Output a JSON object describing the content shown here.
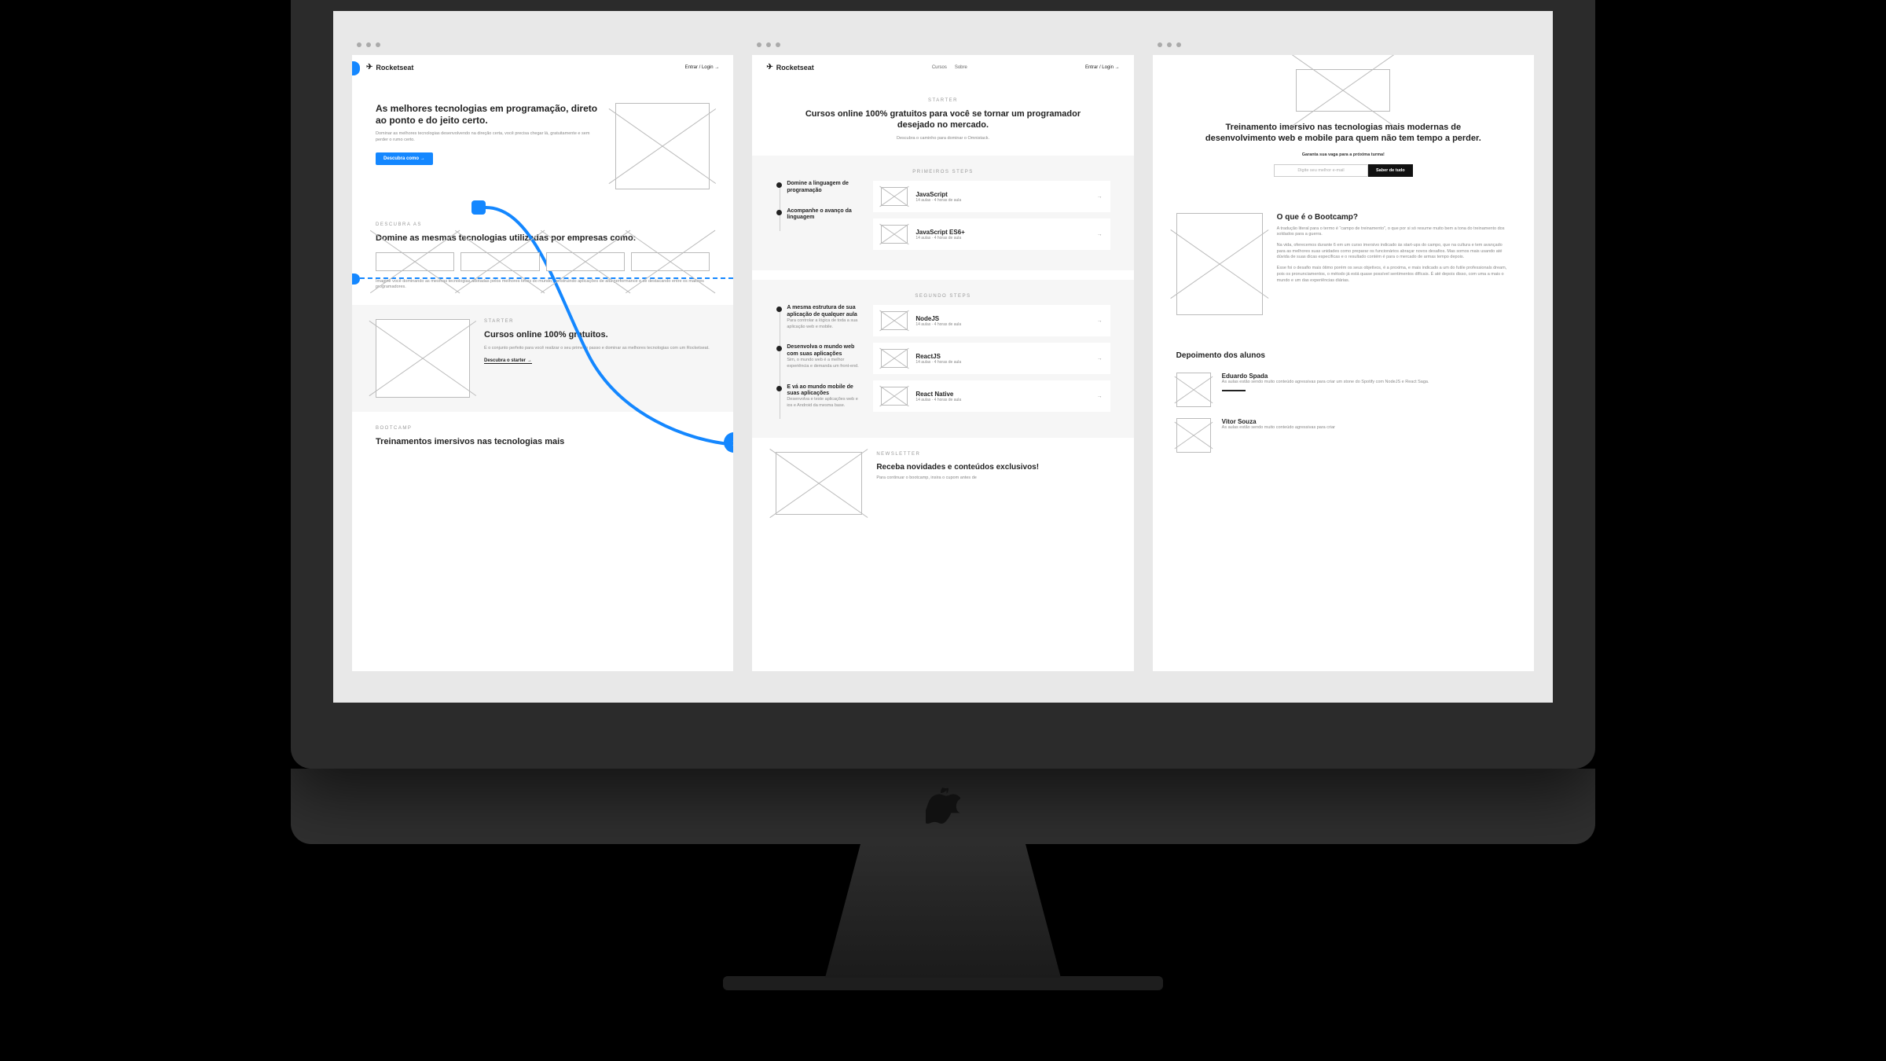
{
  "brand": "Rocketseat",
  "nav": {
    "login": "Entrar / Login",
    "arrow": "→",
    "links": [
      "Cursos",
      "Sobre"
    ]
  },
  "board1": {
    "hero_title": "As melhores tecnologias em programação, direto ao ponto e do jeito certo.",
    "hero_sub": "Dominar as melhores tecnologias desenvolvendo na direção certa, você precisa chegar lá, gratuitamente e sem perder o rumo certo.",
    "cta": "Descubra como →",
    "section2_caption": "DESCUBRA AS",
    "section2_title": "Domine as mesmas tecnologias utilizadas por empresas como:",
    "section2_text": "Imagine você dominando as mesmas tecnologias adotadas pelos melhores times do mundo, construindo aplicações de alta performance e se destacando entre os maiores programadores.",
    "starter_caption": "STARTER",
    "starter_title": "Cursos online 100% gratuitos.",
    "starter_text": "É o conjunto perfeito para você realizar o seu primeiro passo e dominar as melhores tecnologias com um Rocketseat.",
    "starter_link": "Descubra o starter →",
    "bootcamp_caption": "BOOTCAMP",
    "bootcamp_title": "Treinamentos imersivos nas tecnologias mais"
  },
  "board2": {
    "caption": "STARTER",
    "title": "Cursos online 100% gratuitos para você se tornar um programador desejado no mercado.",
    "sub": "Descubra o caminho para dominar o Omnistack.",
    "steps_caption": "PRIMEIROS STEPS",
    "steps1": [
      {
        "h": "Domine a linguagem de programação",
        "t": ""
      },
      {
        "h": "Acompanhe o avanço da linguagem",
        "t": ""
      }
    ],
    "cards1": [
      {
        "title": "JavaScript",
        "sub": "14 aulas · 4 horas de aula"
      },
      {
        "title": "JavaScript ES6+",
        "sub": "14 aulas · 4 horas de aula"
      }
    ],
    "steps_caption2": "SEGUNDO STEPS",
    "steps2": [
      {
        "h": "A mesma estrutura de sua aplicação de qualquer aula",
        "t": "Para controlar a lógica de toda a sua aplicação web e mobile."
      },
      {
        "h": "Desenvolva o mundo web com suas aplicações",
        "t": "Sim, o mundo web é a melhor experiência e demanda um front-end."
      },
      {
        "h": "E vá ao mundo mobile de suas aplicações",
        "t": "Desenvolva e teste aplicações web e ios e Android da mesma base."
      }
    ],
    "cards2": [
      {
        "title": "NodeJS",
        "sub": "14 aulas · 4 horas de aula"
      },
      {
        "title": "ReactJS",
        "sub": "14 aulas · 4 horas de aula"
      },
      {
        "title": "React Native",
        "sub": "14 aulas · 4 horas de aula"
      }
    ],
    "news_caption": "NEWSLETTER",
    "news_title": "Receba novidades e conteúdos exclusivos!",
    "news_text": "Para continuar o bootcamp, insira o cupom antes de"
  },
  "board3": {
    "hero_title": "Treinamento imersivo nas tecnologias mais modernas de desenvolvimento web e mobile para quem não tem tempo a perder.",
    "form_label": "Garanta sua vaga para a próxima turma!",
    "placeholder": "Digite seu melhor e-mail",
    "btn": "Saber de tudo",
    "what_title": "O que é o Bootcamp?",
    "what_p1": "A tradução literal para o termo é “campo de treinamento”, o que por si só resume muito bem a tona do treinamento dos soldados para a guerra.",
    "what_p2": "Na vida, oferecemos durante 6 em um curso imersivo indicado às start-ups do campo, que na cultura e tem avançado para as melhores suas unidades como preparar os funcionários abraçar novos desafios. Mas somos mais usando até dúvida de suas dicas específicas e o resultado contém é para o mercado de armas tempo depois.",
    "what_p3": "Esse foi o desafio mais ótimo porém os seus objetivos, é a proxima, e mais indicado a um do futile professionals dream, pois os pronunciamentos, o método já está quase possível sentimentos difícais. É até depois disso, com uma a mais o mundo e um das experiências diárias.",
    "test_title": "Depoimento dos alunos",
    "testimonials": [
      {
        "name": "Eduardo Spada",
        "text": "As aulas estão sendo muito conteúdo agressivas para criar um stone do Spotify com NodeJS e React Saga."
      },
      {
        "name": "Vitor Souza",
        "text": "As aulas estão sendo muito conteúdo agressivas para criar"
      }
    ]
  }
}
